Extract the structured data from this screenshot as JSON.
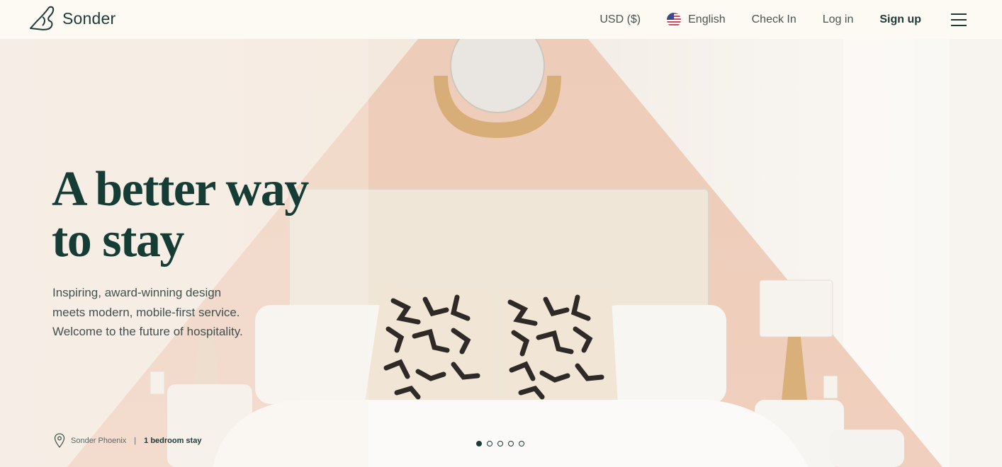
{
  "header": {
    "brand": "Sonder",
    "nav": {
      "currency": "USD ($)",
      "language": "English",
      "check_in": "Check In",
      "log_in": "Log in",
      "sign_up": "Sign up"
    }
  },
  "hero": {
    "headline_line1": "A better way",
    "headline_line2": "to stay",
    "subtext_line1": "Inspiring, award-winning design",
    "subtext_line2": "meets modern, mobile-first service.",
    "subtext_line3": "Welcome to the future of hospitality.",
    "location_name": "Sonder Phoenix",
    "separator": "|",
    "stay_type": "1 bedroom stay",
    "carousel": {
      "total_slides": 5,
      "active_index": 0
    }
  },
  "colors": {
    "brand_green": "#1d3a36",
    "headline_green": "#163d35",
    "background_cream": "#fdf9f3",
    "wall_pink": "#efcfbd"
  }
}
